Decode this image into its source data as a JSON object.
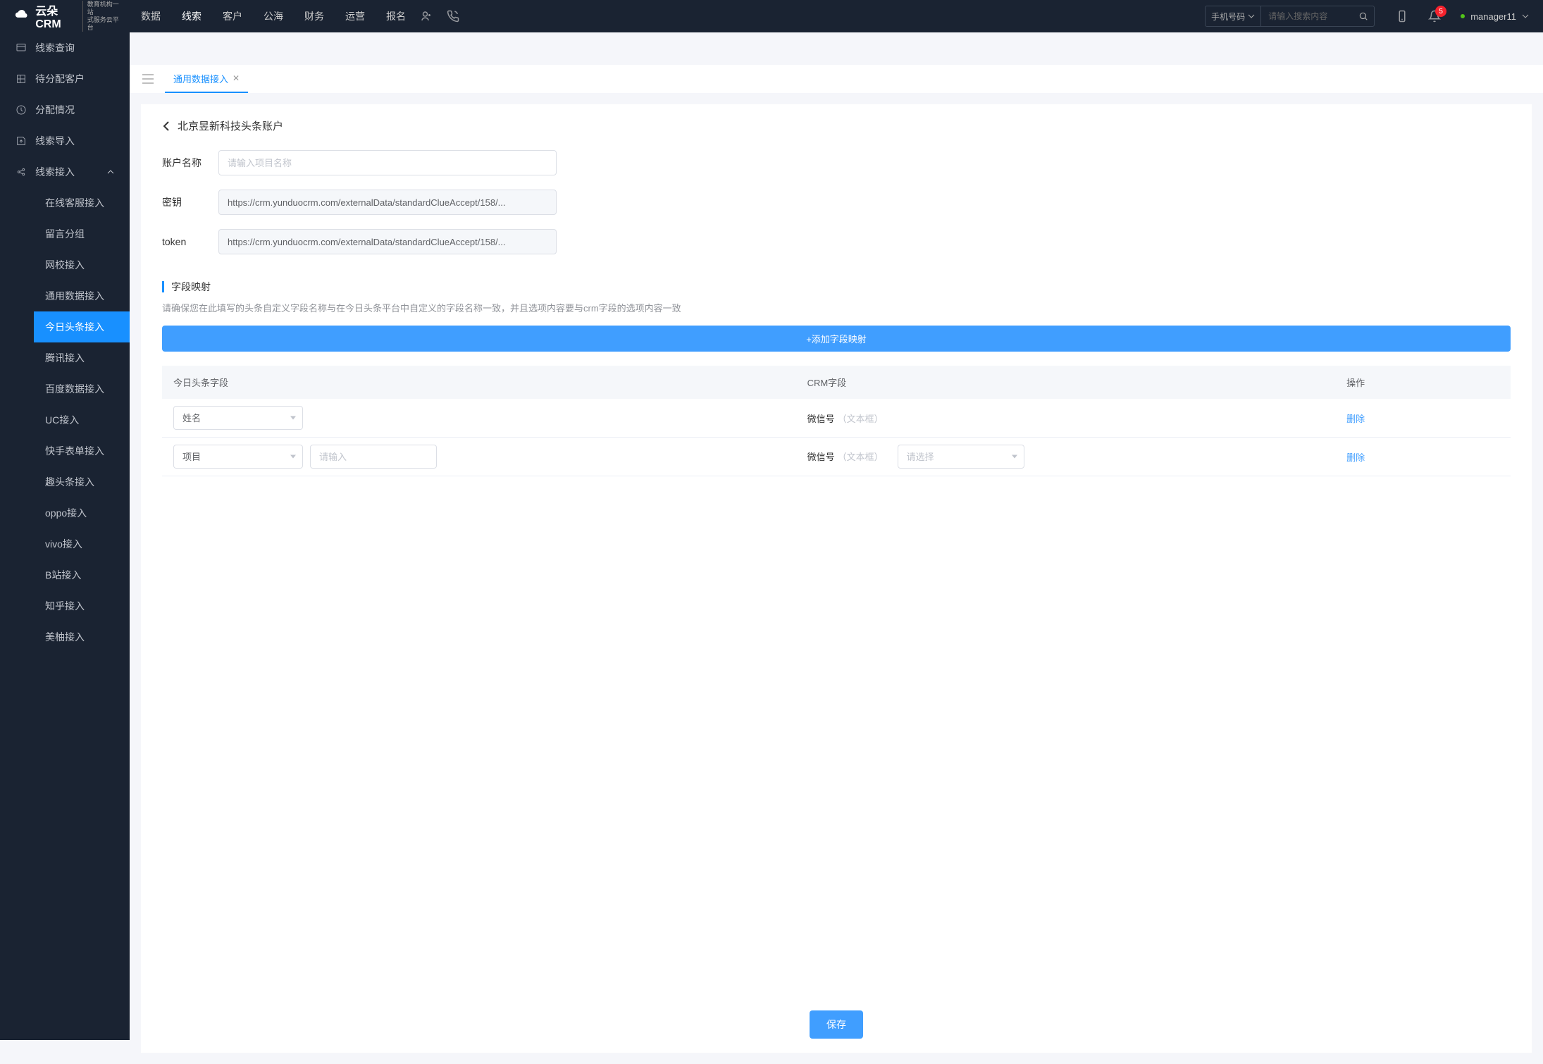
{
  "brand": {
    "name": "云朵CRM",
    "sub1": "教育机构一站",
    "sub2": "式服务云平台"
  },
  "topNav": [
    {
      "label": "数据"
    },
    {
      "label": "线索",
      "active": true
    },
    {
      "label": "客户"
    },
    {
      "label": "公海"
    },
    {
      "label": "财务"
    },
    {
      "label": "运营"
    },
    {
      "label": "报名"
    }
  ],
  "search": {
    "selectLabel": "手机号码",
    "placeholder": "请输入搜索内容"
  },
  "notif": {
    "count": "5"
  },
  "user": {
    "name": "manager11"
  },
  "sidebar": {
    "items": [
      {
        "label": "线索查询"
      },
      {
        "label": "待分配客户"
      },
      {
        "label": "分配情况"
      },
      {
        "label": "线索导入"
      },
      {
        "label": "线索接入",
        "expanded": true,
        "children": [
          {
            "label": "在线客服接入"
          },
          {
            "label": "留言分组"
          },
          {
            "label": "网校接入"
          },
          {
            "label": "通用数据接入"
          },
          {
            "label": "今日头条接入",
            "active": true
          },
          {
            "label": "腾讯接入"
          },
          {
            "label": "百度数据接入"
          },
          {
            "label": "UC接入"
          },
          {
            "label": "快手表单接入"
          },
          {
            "label": "趣头条接入"
          },
          {
            "label": "oppo接入"
          },
          {
            "label": "vivo接入"
          },
          {
            "label": "B站接入"
          },
          {
            "label": "知乎接入"
          },
          {
            "label": "美柚接入"
          }
        ]
      }
    ]
  },
  "tabs": [
    {
      "label": "通用数据接入"
    }
  ],
  "page": {
    "title": "北京昱新科技头条账户",
    "form": {
      "accountLabel": "账户名称",
      "accountPlaceholder": "请输入项目名称",
      "secretLabel": "密钥",
      "secretValue": "https://crm.yunduocrm.com/externalData/standardClueAccept/158/...",
      "tokenLabel": "token",
      "tokenValue": "https://crm.yunduocrm.com/externalData/standardClueAccept/158/..."
    },
    "section": {
      "title": "字段映射",
      "desc": "请确保您在此填写的头条自定义字段名称与在今日头条平台中自定义的字段名称一致，并且选项内容要与crm字段的选项内容一致"
    },
    "addBtn": "+添加字段映射",
    "table": {
      "headers": {
        "c1": "今日头条字段",
        "c2": "CRM字段",
        "c3": "操作"
      },
      "rows": [
        {
          "ttField": "姓名",
          "extraInput": false,
          "crmField": "微信号",
          "crmType": "（文本框）",
          "crmSelect": false,
          "action": "删除"
        },
        {
          "ttField": "项目",
          "extraInput": true,
          "extraPlaceholder": "请输入",
          "crmField": "微信号",
          "crmType": "（文本框）",
          "crmSelect": true,
          "crmSelectPlaceholder": "请选择",
          "action": "删除"
        }
      ]
    },
    "saveBtn": "保存"
  }
}
